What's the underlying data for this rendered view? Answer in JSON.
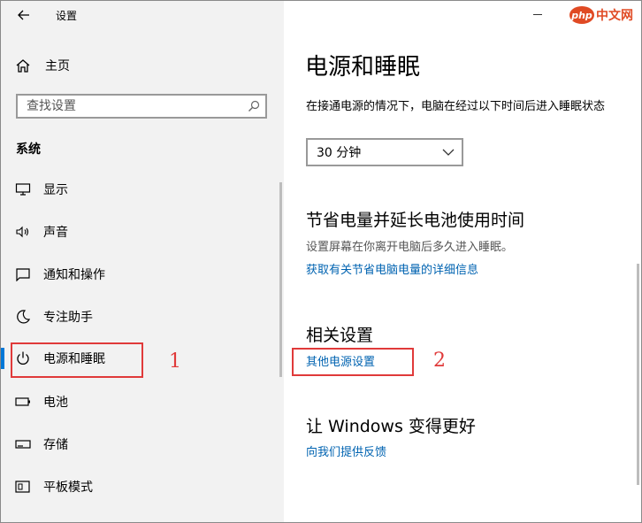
{
  "window": {
    "title": "设置"
  },
  "logo": {
    "badge": "php",
    "text": "中文网"
  },
  "sidebar": {
    "home_label": "主页",
    "search_placeholder": "查找设置",
    "section_heading": "系统",
    "items": [
      {
        "label": "显示",
        "icon": "display-icon"
      },
      {
        "label": "声音",
        "icon": "speaker-icon"
      },
      {
        "label": "通知和操作",
        "icon": "notification-icon"
      },
      {
        "label": "专注助手",
        "icon": "moon-icon"
      },
      {
        "label": "电源和睡眠",
        "icon": "power-icon",
        "selected": true
      },
      {
        "label": "电池",
        "icon": "battery-icon"
      },
      {
        "label": "存储",
        "icon": "storage-icon"
      },
      {
        "label": "平板模式",
        "icon": "tablet-icon"
      }
    ]
  },
  "main": {
    "title": "电源和睡眠",
    "sleep_description": "在接通电源的情况下，电脑在经过以下时间后进入睡眠状态",
    "sleep_dropdown": {
      "selected": "30 分钟"
    },
    "save_power": {
      "heading": "节省电量并延长电池使用时间",
      "description": "设置屏幕在你离开电脑后多久进入睡眠。",
      "link": "获取有关节省电脑电量的详细信息"
    },
    "related": {
      "heading": "相关设置",
      "link": "其他电源设置"
    },
    "feedback": {
      "heading": "让 Windows 变得更好",
      "link": "向我们提供反馈"
    }
  },
  "annotations": {
    "label1": "1",
    "label2": "2"
  },
  "colors": {
    "accent": "#0078d7",
    "link": "#0063b1",
    "annotation": "#e03a3a",
    "sidebar_bg": "#f2f2f2"
  }
}
